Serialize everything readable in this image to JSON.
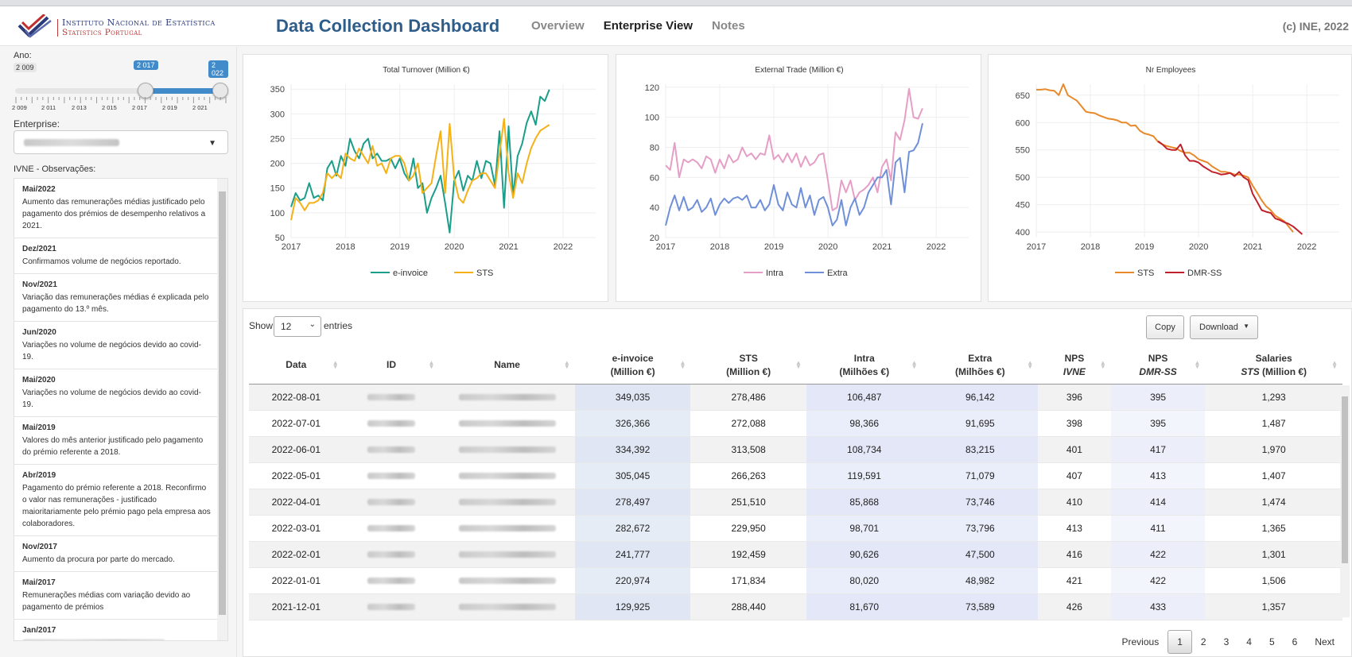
{
  "header": {
    "logo_line1": "Instituto Nacional de Estatística",
    "logo_line2": "Statistics Portugal",
    "title": "Data Collection Dashboard",
    "nav": [
      "Overview",
      "Enterprise View",
      "Notes"
    ],
    "active_nav": "Enterprise View",
    "copyright": "(c) INE, 2022"
  },
  "sidebar": {
    "year_label": "Ano:",
    "slider": {
      "min_label": "2 009",
      "max_label": "2 022",
      "from_label": "2 017",
      "to_label": "2 022",
      "min": 2009,
      "max": 2022,
      "from": 2017,
      "to": 2022,
      "tick_labels": [
        "2 009",
        "2 011",
        "2 013",
        "2 015",
        "2 017",
        "2 019",
        "2 021"
      ]
    },
    "enterprise_label": "Enterprise:",
    "obs_label": "IVNE - Observações:",
    "observations": [
      {
        "date": "Mai/2022",
        "text": "Aumento das remunerações médias justificado pelo pagamento dos prémios de desempenho relativos a 2021."
      },
      {
        "date": "Dez/2021",
        "text": "Confirmamos volume de negócios reportado."
      },
      {
        "date": "Nov/2021",
        "text": "Variação das remunerações médias é explicada pelo pagamento do 13.º mês."
      },
      {
        "date": "Jun/2020",
        "text": "Variações no volume de negócios devido ao covid-19."
      },
      {
        "date": "Mai/2020",
        "text": "Variações no volume de negócios devido ao covid-19."
      },
      {
        "date": "Mai/2019",
        "text": "Valores do mês anterior justificado pelo pagamento do prémio referente a 2018."
      },
      {
        "date": "Abr/2019",
        "text": "Pagamento do prémio referente a 2018. Reconfirmo o valor nas remunerações - justificado maioritariamente pelo prémio pago pela empresa aos colaboradores."
      },
      {
        "date": "Nov/2017",
        "text": "Aumento da procura por parte do mercado."
      },
      {
        "date": "Mai/2017",
        "text": "Remunerações médias com variação devido ao pagamento de prémios"
      },
      {
        "date": "Jan/2017",
        "text": ""
      }
    ]
  },
  "chart_data": [
    {
      "type": "line",
      "title": "Total Turnover (Million €)",
      "x_ticks": [
        "2017",
        "2018",
        "2019",
        "2020",
        "2021",
        "2022"
      ],
      "xlim": [
        2017,
        2022.6
      ],
      "y_ticks": [
        50,
        100,
        150,
        200,
        250,
        300,
        350
      ],
      "ylim": [
        50,
        360
      ],
      "legend": "bottom",
      "series": [
        {
          "name": "e-invoice",
          "color": "#1a9e8a",
          "start": 2017.0,
          "step": 0.0833,
          "values": [
            112,
            140,
            125,
            130,
            160,
            130,
            135,
            125,
            190,
            205,
            175,
            215,
            195,
            250,
            225,
            210,
            240,
            250,
            210,
            220,
            205,
            205,
            210,
            190,
            210,
            180,
            165,
            210,
            150,
            160,
            100,
            130,
            150,
            175,
            120,
            60,
            165,
            185,
            145,
            175,
            165,
            205,
            170,
            205,
            200,
            155,
            265,
            110,
            275,
            135,
            215,
            240,
            282,
            305,
            278,
            335,
            326,
            349
          ]
        },
        {
          "name": "STS",
          "color": "#f5b118",
          "start": 2017.0,
          "step": 0.0833,
          "values": [
            85,
            130,
            120,
            105,
            120,
            120,
            125,
            140,
            180,
            170,
            180,
            170,
            220,
            210,
            205,
            230,
            215,
            200,
            235,
            195,
            200,
            180,
            210,
            215,
            215,
            200,
            165,
            175,
            200,
            140,
            150,
            160,
            215,
            265,
            140,
            280,
            170,
            130,
            120,
            145,
            165,
            170,
            180,
            180,
            165,
            150,
            220,
            290,
            180,
            130,
            180,
            160,
            200,
            231,
            251,
            266,
            272,
            278
          ]
        }
      ]
    },
    {
      "type": "line",
      "title": "External Trade (Million €)",
      "x_ticks": [
        "2017",
        "2018",
        "2019",
        "2020",
        "2021",
        "2022"
      ],
      "xlim": [
        2017,
        2022.6
      ],
      "y_ticks": [
        20,
        40,
        60,
        80,
        100,
        120
      ],
      "ylim": [
        20,
        122
      ],
      "legend": "bottom",
      "series": [
        {
          "name": "Intra",
          "color": "#e59fc6",
          "start": 2017.0,
          "step": 0.0833,
          "values": [
            68,
            65,
            83,
            60,
            72,
            70,
            72,
            70,
            66,
            74,
            72,
            63,
            72,
            66,
            75,
            70,
            72,
            80,
            74,
            76,
            72,
            76,
            75,
            88,
            72,
            75,
            70,
            76,
            70,
            76,
            67,
            74,
            68,
            70,
            75,
            76,
            58,
            38,
            40,
            58,
            50,
            58,
            45,
            50,
            52,
            55,
            60,
            50,
            67,
            72,
            58,
            90,
            85,
            98,
            119,
            100,
            99,
            106
          ]
        },
        {
          "name": "Extra",
          "color": "#6f90d8",
          "start": 2017.0,
          "step": 0.0833,
          "values": [
            28,
            40,
            48,
            38,
            47,
            38,
            40,
            45,
            37,
            40,
            46,
            35,
            42,
            46,
            43,
            46,
            47,
            45,
            48,
            40,
            40,
            45,
            38,
            42,
            55,
            42,
            38,
            50,
            42,
            40,
            53,
            40,
            48,
            35,
            45,
            47,
            40,
            28,
            32,
            45,
            28,
            40,
            46,
            35,
            40,
            50,
            55,
            60,
            60,
            65,
            42,
            70,
            73,
            50,
            77,
            78,
            83,
            96
          ]
        }
      ]
    },
    {
      "type": "line",
      "title": "Nr Employees",
      "x_ticks": [
        "2017",
        "2018",
        "2019",
        "2020",
        "2021",
        "2022"
      ],
      "xlim": [
        2017,
        2022.6
      ],
      "y_ticks": [
        400,
        450,
        500,
        550,
        600,
        650
      ],
      "ylim": [
        390,
        670
      ],
      "legend": "bottom",
      "series": [
        {
          "name": "STS",
          "color": "#e8892a",
          "start": 2017.0,
          "step": 0.0833,
          "values": [
            660,
            660,
            661,
            659,
            658,
            650,
            670,
            650,
            645,
            640,
            630,
            620,
            618,
            617,
            613,
            610,
            607,
            606,
            604,
            600,
            600,
            594,
            595,
            585,
            580,
            578,
            575,
            565,
            560,
            557,
            555,
            553,
            548,
            545,
            545,
            540,
            533,
            530,
            527,
            520,
            515,
            510,
            510,
            508,
            505,
            505,
            503,
            500,
            485,
            472,
            458,
            447,
            440,
            430,
            425,
            420,
            410,
            400
          ]
        },
        {
          "name": "DMR-SS",
          "color": "#c0202a",
          "start": 2019.25,
          "step": 0.0833,
          "values": [
            566,
            560,
            552,
            550,
            550,
            560,
            540,
            530,
            530,
            527,
            520,
            515,
            510,
            508,
            505,
            506,
            508,
            502,
            510,
            500,
            495,
            470,
            455,
            440,
            437,
            435,
            425,
            422,
            418,
            415,
            410,
            403,
            396
          ]
        }
      ]
    }
  ],
  "table": {
    "show_label": "Show",
    "page_length": "12",
    "entries_label": "entries",
    "copy_label": "Copy",
    "download_label": "Download",
    "columns": [
      {
        "l1": "Data",
        "l2": ""
      },
      {
        "l1": "ID",
        "l2": ""
      },
      {
        "l1": "Name",
        "l2": ""
      },
      {
        "l1": "e-invoice",
        "l2": "(Million €)"
      },
      {
        "l1": "STS",
        "l2": "(Million €)"
      },
      {
        "l1": "Intra",
        "l2": "(Milhões €)"
      },
      {
        "l1": "Extra",
        "l2": "(Milhões €)"
      },
      {
        "l1": "NPS",
        "l2": "IVNE"
      },
      {
        "l1": "NPS",
        "l2": "DMR-SS"
      },
      {
        "l1": "Salaries",
        "l2": "STS",
        "l2b": " (Million €)"
      }
    ],
    "rows": [
      [
        "2022-08-01",
        "349,035",
        "278,486",
        "106,487",
        "96,142",
        "396",
        "395",
        "1,293"
      ],
      [
        "2022-07-01",
        "326,366",
        "272,088",
        "98,366",
        "91,695",
        "398",
        "395",
        "1,487"
      ],
      [
        "2022-06-01",
        "334,392",
        "313,508",
        "108,734",
        "83,215",
        "401",
        "417",
        "1,970"
      ],
      [
        "2022-05-01",
        "305,045",
        "266,263",
        "119,591",
        "71,079",
        "407",
        "413",
        "1,407"
      ],
      [
        "2022-04-01",
        "278,497",
        "251,510",
        "85,868",
        "73,746",
        "410",
        "414",
        "1,474"
      ],
      [
        "2022-03-01",
        "282,672",
        "229,950",
        "98,701",
        "73,796",
        "413",
        "411",
        "1,365"
      ],
      [
        "2022-02-01",
        "241,777",
        "192,459",
        "90,626",
        "47,500",
        "416",
        "422",
        "1,301"
      ],
      [
        "2022-01-01",
        "220,974",
        "171,834",
        "80,020",
        "48,982",
        "421",
        "422",
        "1,506"
      ],
      [
        "2021-12-01",
        "129,925",
        "288,440",
        "81,670",
        "73,589",
        "426",
        "433",
        "1,357"
      ]
    ],
    "pager": {
      "previous": "Previous",
      "pages": [
        "1",
        "2",
        "3",
        "4",
        "5",
        "6"
      ],
      "current": "1",
      "next": "Next"
    }
  }
}
